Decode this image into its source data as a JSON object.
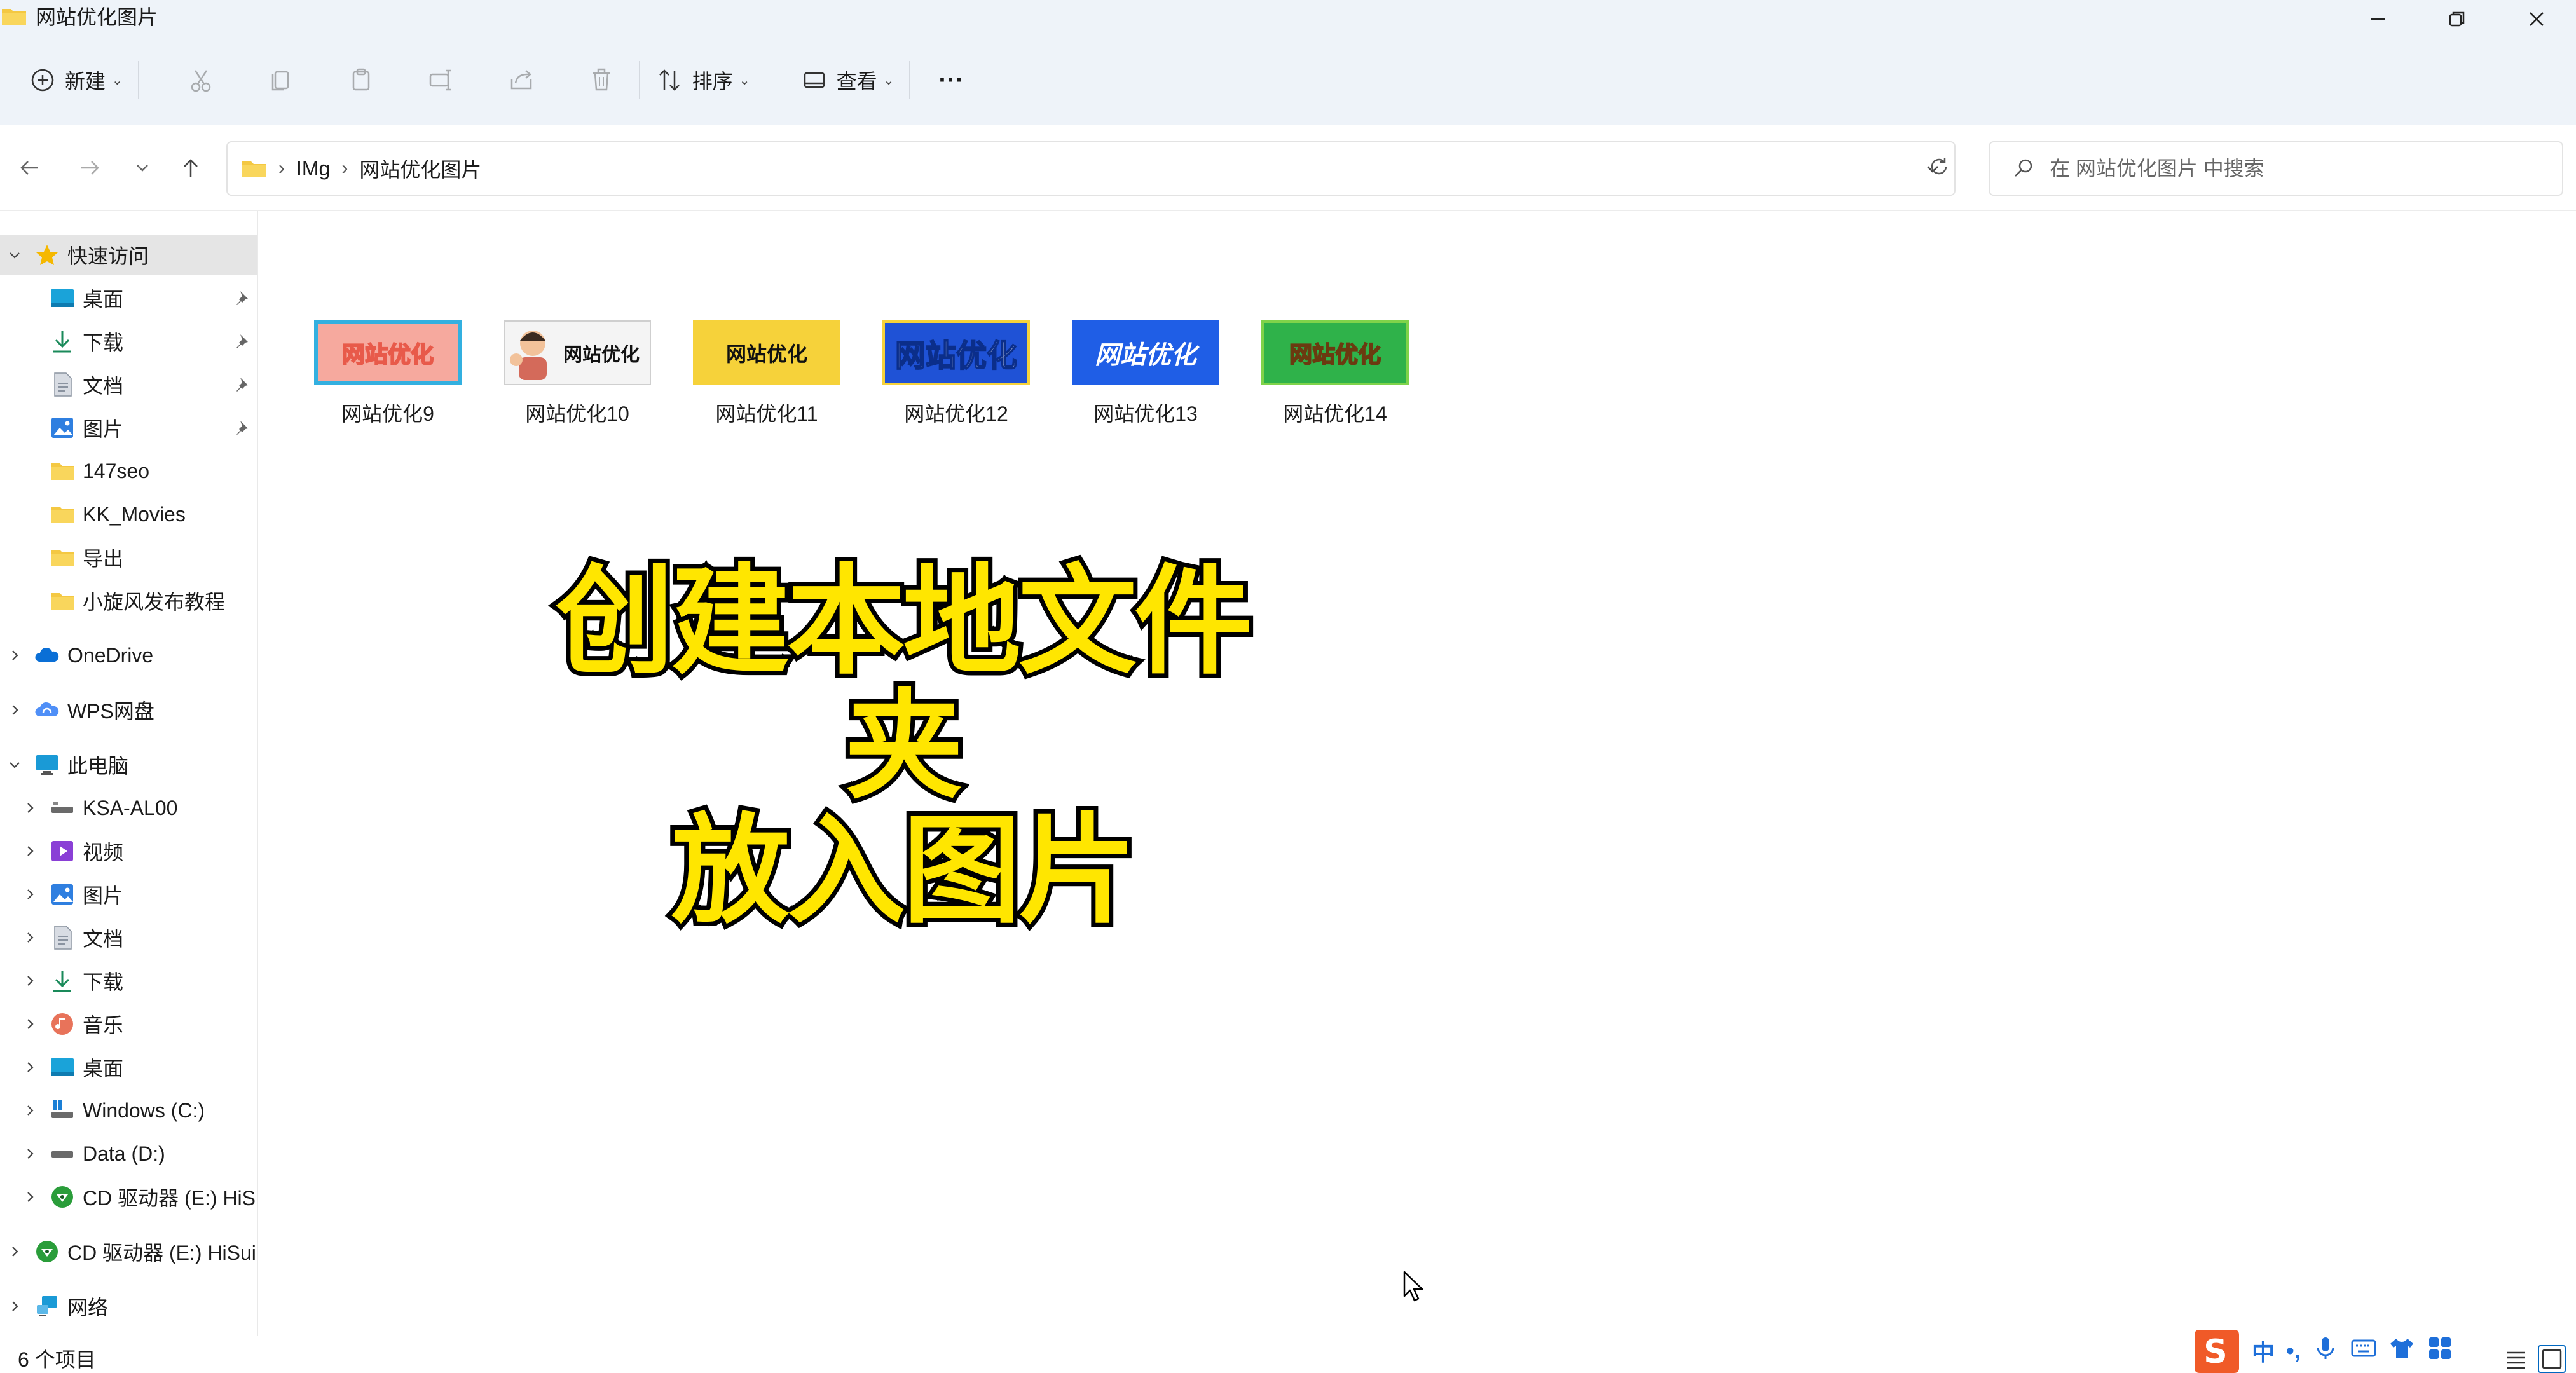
{
  "window": {
    "title": "网站优化图片"
  },
  "commandbar": {
    "new_label": "新建",
    "sort_label": "排序",
    "view_label": "查看",
    "more_label": "···"
  },
  "navigation": {
    "breadcrumb": [
      "IMg",
      "网站优化图片"
    ],
    "search_placeholder": "在 网站优化图片 中搜索"
  },
  "sidebar": {
    "quick_access": "快速访问",
    "quick_items": [
      "桌面",
      "下载",
      "文档",
      "图片",
      "147seo",
      "KK_Movies",
      "导出",
      "小旋风发布教程"
    ],
    "onedrive": "OneDrive",
    "wps": "WPS网盘",
    "this_pc": "此电脑",
    "pc_items": [
      "KSA-AL00",
      "视频",
      "图片",
      "文档",
      "下载",
      "音乐",
      "桌面",
      "Windows (C:)",
      "Data (D:)",
      "CD 驱动器 (E:) HiSu"
    ],
    "cd_drive": "CD 驱动器 (E:) HiSui",
    "network": "网络"
  },
  "files": [
    {
      "name": "网站优化9",
      "thumb_text": "网站优化",
      "bg": "#f3a8a0",
      "fg": "#ffffff"
    },
    {
      "name": "网站优化10",
      "thumb_text": "网站优化",
      "bg": "#ffffff",
      "fg": "#111111"
    },
    {
      "name": "网站优化11",
      "thumb_text": "网站优化",
      "bg": "#f6d23a",
      "fg": "#111111"
    },
    {
      "name": "网站优化12",
      "thumb_text": "网站优化",
      "bg": "#1f52d6",
      "fg": "#ffffff"
    },
    {
      "name": "网站优化13",
      "thumb_text": "网站优化",
      "bg": "#1f5ee6",
      "fg": "#ffffff"
    },
    {
      "name": "网站优化14",
      "thumb_text": "网站优化",
      "bg": "#2fb24a",
      "fg": "#ffe23a"
    }
  ],
  "overlay": {
    "line1": "创建本地文件夹",
    "line2": "放入图片"
  },
  "status": {
    "item_count": "6 个项目"
  },
  "ime": {
    "mode": "中",
    "punct": "•,"
  },
  "colors": {
    "accent": "#0067c0",
    "folder": "#f4c842",
    "overlay_text": "#ffe600"
  }
}
